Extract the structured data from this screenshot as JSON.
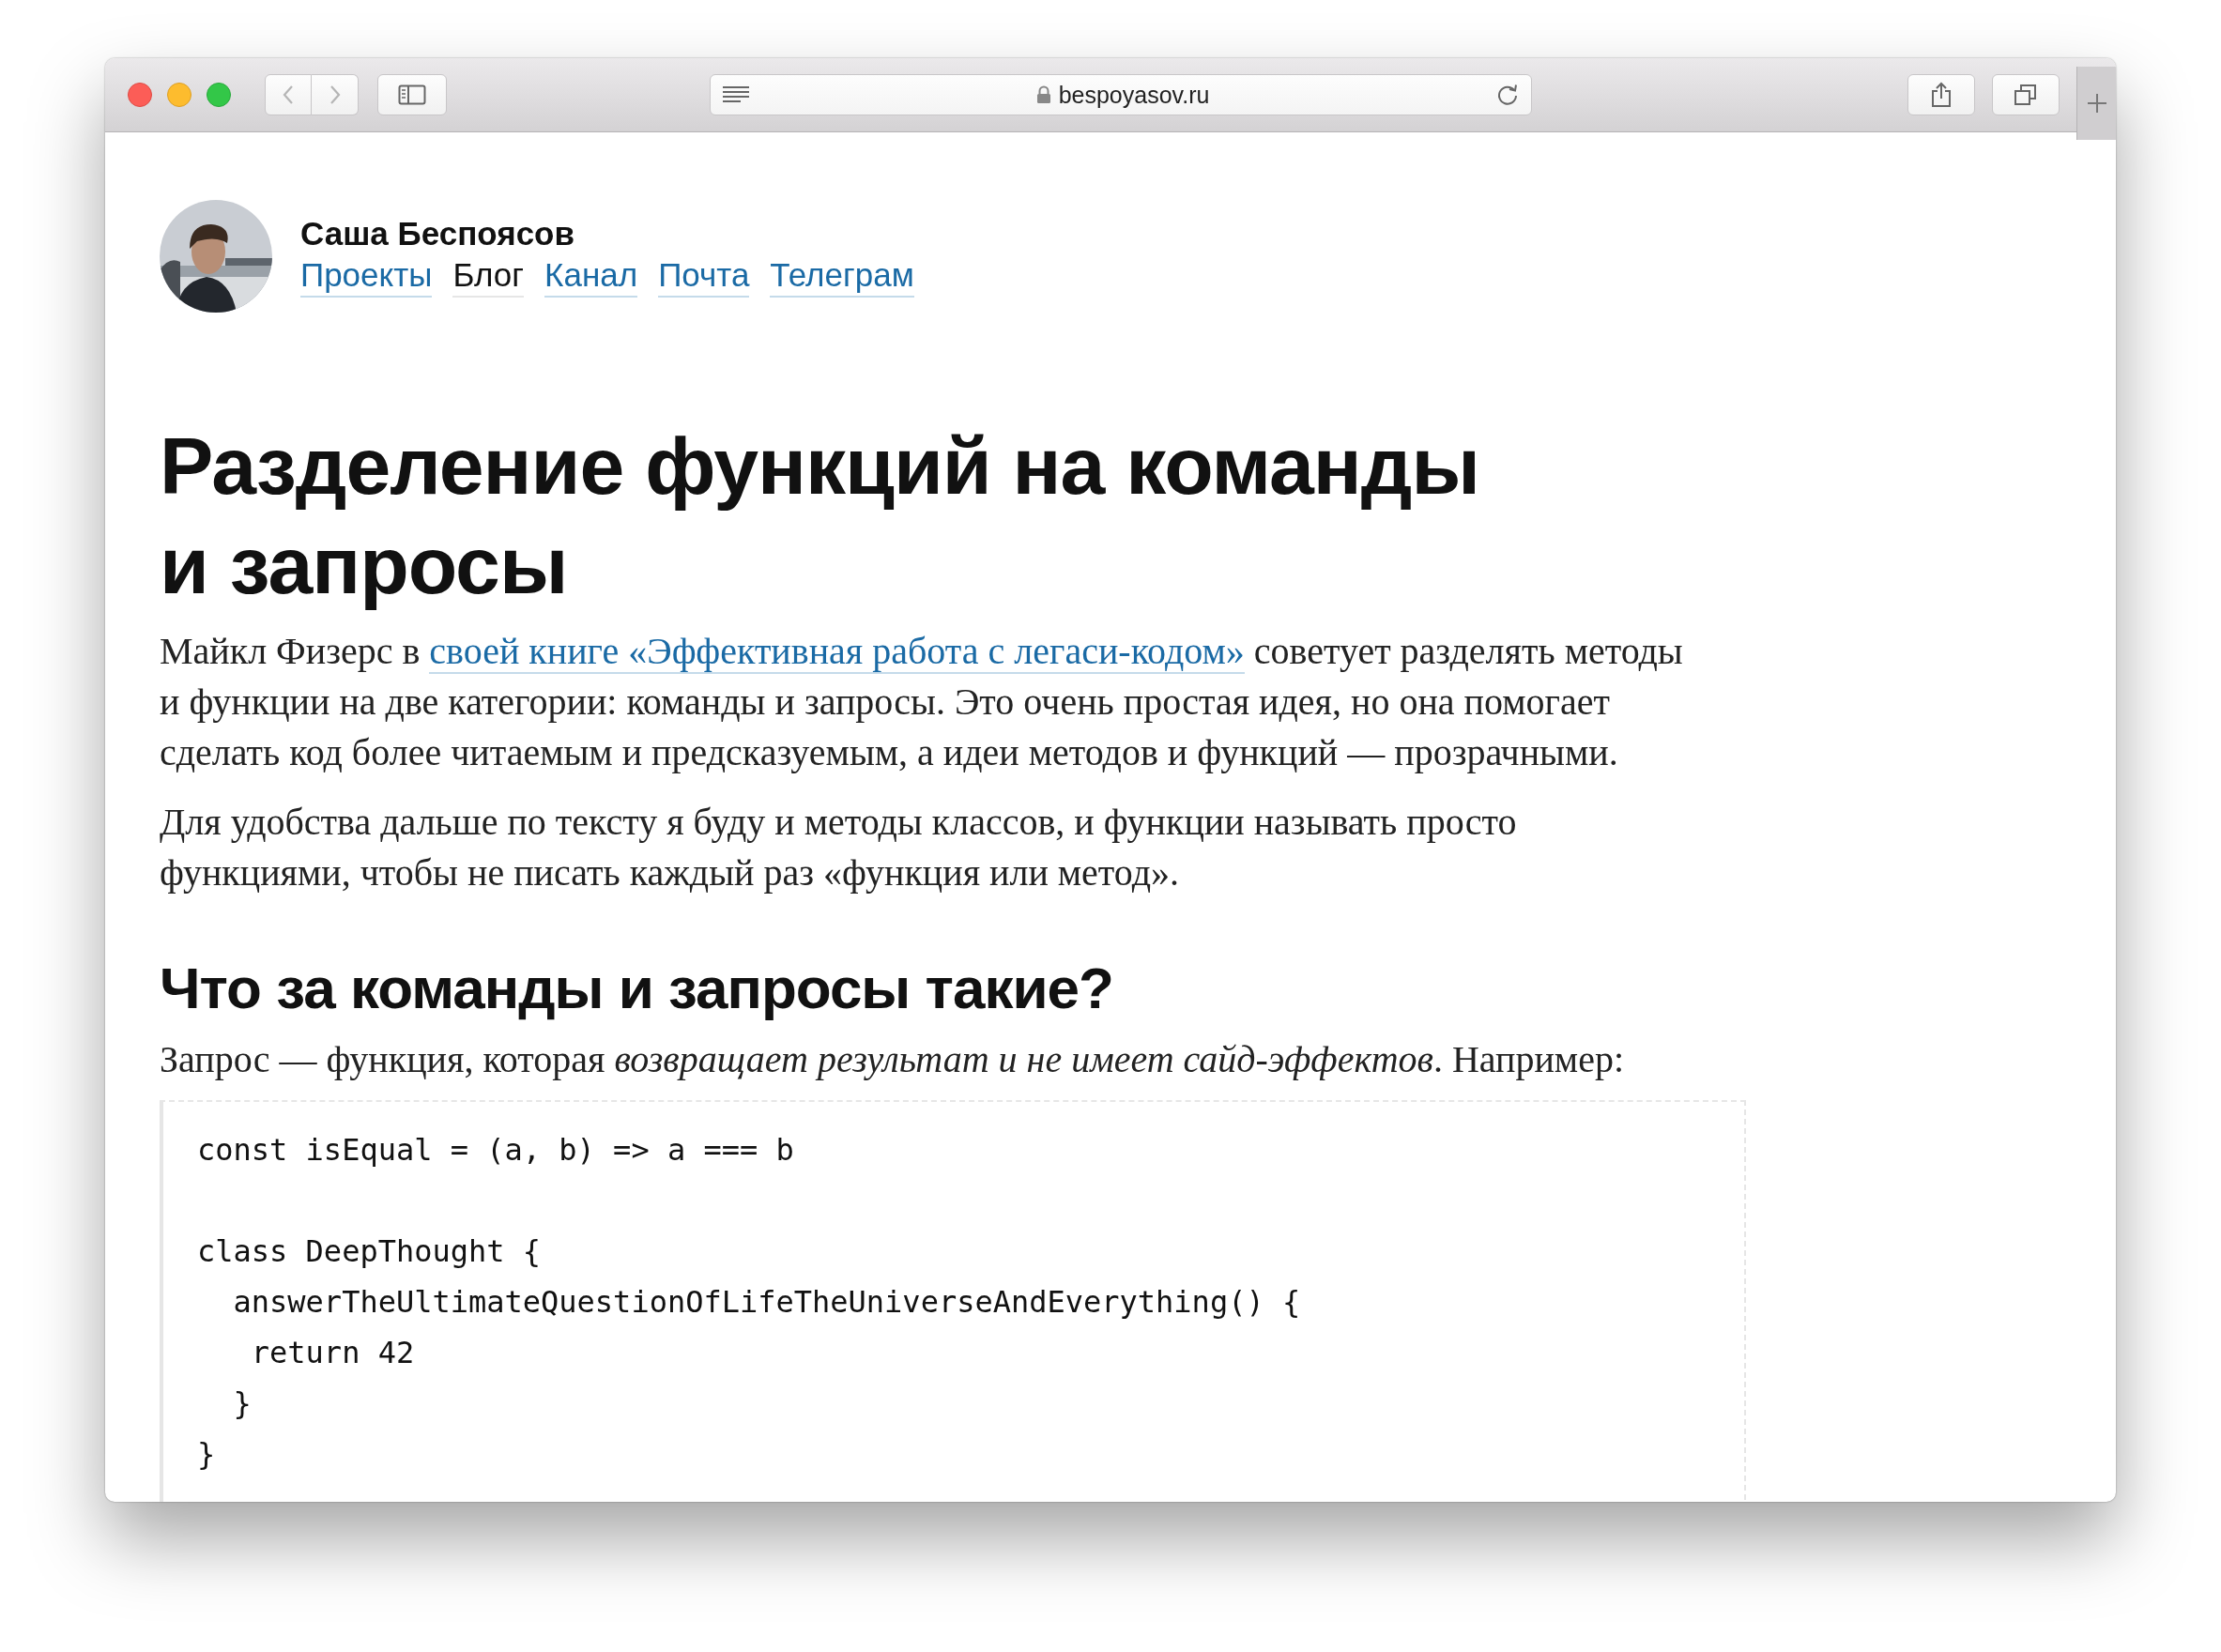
{
  "browser": {
    "url": "bespoyasov.ru"
  },
  "author": {
    "name": "Саша Беспоясов"
  },
  "nav": [
    {
      "label": "Проекты",
      "selected": false
    },
    {
      "label": "Блог",
      "selected": true
    },
    {
      "label": "Канал",
      "selected": false
    },
    {
      "label": "Почта",
      "selected": false
    },
    {
      "label": "Телеграм",
      "selected": false
    }
  ],
  "article": {
    "title": "Разделение функций на команды и запросы",
    "intro": {
      "before": "Майкл Физерс в ",
      "link": "своей книге «Эффективная работа с легаси-кодом»",
      "after": " советует разделять методы и функции на две категории: команды и запросы. Это очень простая идея, но она помогает сделать код более читаемым и предсказуемым, а идеи методов и функций — прозрачными."
    },
    "paragraph": "Для удобства дальше по тексту я буду и методы классов, и функции называть просто функциями, чтобы не писать каждый раз «функция или метод».",
    "heading": "Что за команды и запросы такие?",
    "query_text": "Запрос — функция, которая *возвращает результат и не имеет сайд-эффектов*. Например:",
    "code": [
      [
        "const isEqual = (a, b) => a === b"
      ],
      [
        "class DeepThought {",
        "  answerTheUltimateQuestionOfLifeTheUniverseAndEverything() {",
        "   return 42",
        "  }",
        "}"
      ]
    ]
  }
}
